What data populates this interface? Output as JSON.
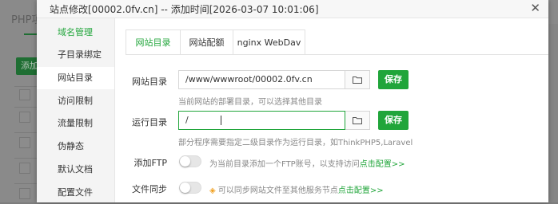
{
  "background": {
    "title": "PHP项",
    "add_button": "添加"
  },
  "dialog": {
    "title": "站点修改[00002.0fv.cn] -- 添加时间[2026-03-07 10:01:06]",
    "close": "✕"
  },
  "sidebar": {
    "items": [
      {
        "label": "域名管理"
      },
      {
        "label": "子目录绑定"
      },
      {
        "label": "网站目录"
      },
      {
        "label": "访问限制"
      },
      {
        "label": "流量限制"
      },
      {
        "label": "伪静态"
      },
      {
        "label": "默认文档"
      },
      {
        "label": "配置文件"
      }
    ]
  },
  "tabs": [
    {
      "label": "网站目录"
    },
    {
      "label": "网站配额"
    },
    {
      "label": "nginx WebDav"
    }
  ],
  "site_dir": {
    "label": "网站目录",
    "value": "/www/wwwroot/00002.0fv.cn",
    "save": "保存",
    "hint": "当前网站的部署目录，可以选择其他目录"
  },
  "run_dir": {
    "label": "运行目录",
    "value": "/",
    "save": "保存",
    "hint": "部分程序需要指定二级目录作为运行目录，如ThinkPHP5,Laravel"
  },
  "ftp": {
    "label": "添加FTP",
    "hint": "为当前目录添加一个FTP账号，以支持访问",
    "link": "点击配置>>"
  },
  "sync": {
    "label": "文件同步",
    "hint": "可以同步网站文件至其他服务节点",
    "link": "点击配置>>"
  },
  "colors": {
    "accent": "#20a53a"
  }
}
